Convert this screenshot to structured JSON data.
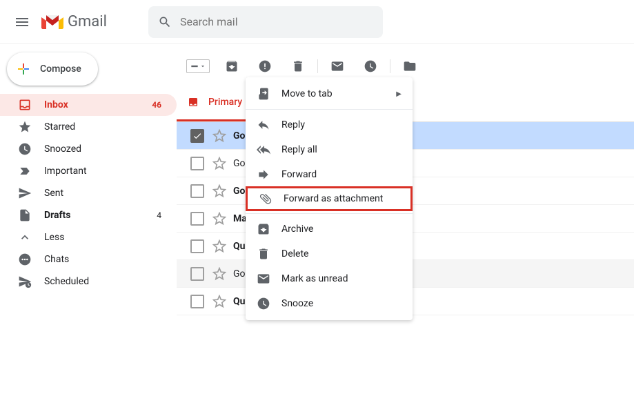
{
  "header": {
    "app_name": "Gmail",
    "search_placeholder": "Search mail"
  },
  "sidebar": {
    "compose_label": "Compose",
    "items": [
      {
        "icon": "inbox",
        "label": "Inbox",
        "count": "46",
        "active": true
      },
      {
        "icon": "star",
        "label": "Starred"
      },
      {
        "icon": "clock",
        "label": "Snoozed"
      },
      {
        "icon": "important",
        "label": "Important"
      },
      {
        "icon": "send",
        "label": "Sent"
      },
      {
        "icon": "draft",
        "label": "Drafts",
        "count": "4",
        "bold": true
      },
      {
        "icon": "less",
        "label": "Less"
      },
      {
        "icon": "chats",
        "label": "Chats"
      },
      {
        "icon": "scheduled",
        "label": "Scheduled"
      }
    ]
  },
  "main": {
    "tab_primary": "Primary",
    "emails": [
      {
        "sender": "Go",
        "selected": true
      },
      {
        "sender": "Go"
      },
      {
        "sender": "Go"
      },
      {
        "sender": "Ma"
      },
      {
        "sender": "Qu",
        "bold": true
      },
      {
        "sender": "Go"
      },
      {
        "sender": "Qu",
        "bold": true
      }
    ]
  },
  "contextMenu": {
    "move_to_tab": "Move to tab",
    "reply": "Reply",
    "reply_all": "Reply all",
    "forward": "Forward",
    "forward_as_attachment": "Forward as attachment",
    "archive": "Archive",
    "delete": "Delete",
    "mark_as_unread": "Mark as unread",
    "snooze": "Snooze"
  }
}
